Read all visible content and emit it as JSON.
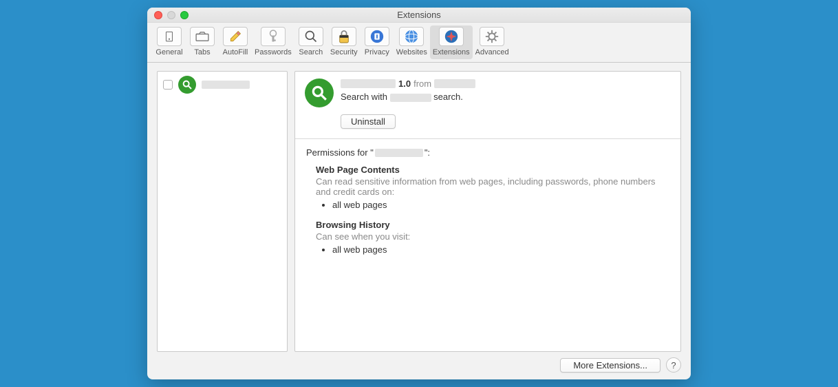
{
  "window": {
    "title": "Extensions"
  },
  "toolbar": {
    "items": [
      {
        "label": "General"
      },
      {
        "label": "Tabs"
      },
      {
        "label": "AutoFill"
      },
      {
        "label": "Passwords"
      },
      {
        "label": "Search"
      },
      {
        "label": "Security"
      },
      {
        "label": "Privacy"
      },
      {
        "label": "Websites"
      },
      {
        "label": "Extensions"
      },
      {
        "label": "Advanced"
      }
    ]
  },
  "sidebar": {
    "items": [
      {
        "name_redacted": true
      }
    ]
  },
  "detail": {
    "version": "1.0",
    "from_label": "from",
    "description_prefix": "Search with",
    "description_suffix": "search.",
    "uninstall_label": "Uninstall"
  },
  "permissions": {
    "prefix": "Permissions for \"",
    "suffix": "\":",
    "sections": [
      {
        "heading": "Web Page Contents",
        "sub": "Can read sensitive information from web pages, including passwords, phone numbers and credit cards on:",
        "items": [
          "all web pages"
        ]
      },
      {
        "heading": "Browsing History",
        "sub": "Can see when you visit:",
        "items": [
          "all web pages"
        ]
      }
    ]
  },
  "footer": {
    "more_extensions": "More Extensions...",
    "help": "?"
  }
}
